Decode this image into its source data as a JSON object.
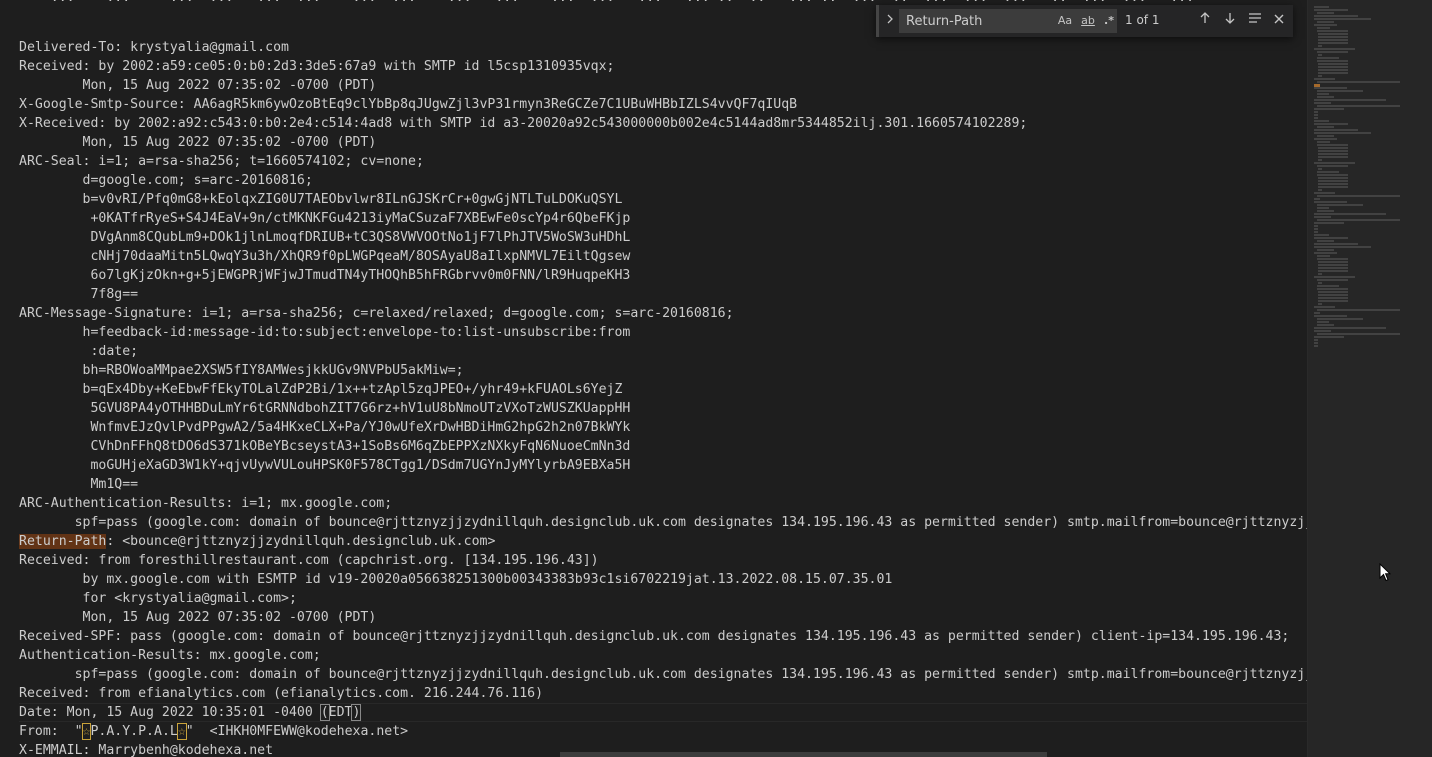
{
  "editor": {
    "cut_top_text": "    ...    ...     ...  ...   ...  ...    ...  ...    ...   ...    ...  ...   ...   ... ..  ..   ... ..  ...  ..  ...  ...  ...   ..  ...  ...   ... ",
    "lines": [
      "Delivered-To: krystyalia@gmail.com",
      "Received: by 2002:a59:ce05:0:b0:2d3:3de5:67a9 with SMTP id l5csp1310935vqx;",
      "        Mon, 15 Aug 2022 07:35:02 -0700 (PDT)",
      "X-Google-Smtp-Source: AA6agR5km6ywOzoBtEq9clYbBp8qJUgwZjl3vP31rmyn3ReGCZe7C1UBuWHBbIZLS4vvQF7qIUqB",
      "X-Received: by 2002:a92:c543:0:b0:2e4:c514:4ad8 with SMTP id a3-20020a92c543000000b002e4c5144ad8mr5344852ilj.301.1660574102289;",
      "        Mon, 15 Aug 2022 07:35:02 -0700 (PDT)",
      "ARC-Seal: i=1; a=rsa-sha256; t=1660574102; cv=none;",
      "        d=google.com; s=arc-20160816;",
      "        b=v0vRI/Pfq0mG8+kEolqxZIG0U7TAEObvlwr8ILnGJSKrCr+0gwGjNTLTuLDOKuQSYL",
      "         +0KATfrRyeS+S4J4EaV+9n/ctMKNKFGu4213iyMaCSuzaF7XBEwFe0scYp4r6QbeFKjp",
      "         DVgAnm8CQubLm9+DOk1jlnLmoqfDRIUB+tC3QS8VWVOOtNo1jF7lPhJTV5WoSW3uHDhL",
      "         cNHj70daaMitn5LQwqY3u3h/XhQR9f0pLWGPqeaM/8OSAyaU8aIlxpNMVL7EiltQgsew",
      "         6o7lgKjzOkn+g+5jEWGPRjWFjwJTmudTN4yTHOQhB5hFRGbrvv0m0FNN/lR9HuqpeKH3",
      "         7f8g==",
      "ARC-Message-Signature: i=1; a=rsa-sha256; c=relaxed/relaxed; d=google.com; s=arc-20160816;",
      "        h=feedback-id:message-id:to:subject:envelope-to:list-unsubscribe:from",
      "         :date;",
      "        bh=RBOWoaMMpae2XSW5fIY8AMWesjkkUGv9NVPbU5akMiw=;",
      "        b=qEx4Dby+KeEbwFfEkyTOLalZdP2Bi/1x++tzApl5zqJPEO+/yhr49+kFUAOLs6YejZ",
      "         5GVU8PA4yOTHHBDuLmYr6tGRNNdbohZIT7G6rz+hV1uU8bNmoUTzVXoTzWUSZKUappHH",
      "         WnfmvEJzQvlPvdPPgwA2/5a4HKxeCLX+Pa/YJ0wUfeXrDwHBDiHmG2hpG2h2n07BkWYk",
      "         CVhDnFFhQ8tDO6dS371kOBeYBcseystA3+1SoBs6M6qZbEPPXzNXkyFqN6NuoeCmNn3d",
      "         moGUHjeXaGD3W1kY+qjvUywVULouHPSK0F578CTgg1/DSdm7UGYnJyMYlyrbA9EBXa5H",
      "         Mm1Q==",
      "ARC-Authentication-Results: i=1; mx.google.com;",
      "       spf=pass (google.com: domain of bounce@rjttznyzjjzydnillquh.designclub.uk.com designates 134.195.196.43 as permitted sender) smtp.mailfrom=bounce@rjttznyzjjzydnillquh.designclub.uk.com"
    ],
    "return_path": {
      "key": "Return-Path",
      "rest": ": <bounce@rjttznyzjjzydnillquh.designclub.uk.com>"
    },
    "lines_after": [
      "Received: from foresthillrestaurant.com (capchrist.org. [134.195.196.43])",
      "        by mx.google.com with ESMTP id v19-20020a056638251300b00343383b93c1si6702219jat.13.2022.08.15.07.35.01",
      "        for <krystyalia@gmail.com>;",
      "        Mon, 15 Aug 2022 07:35:02 -0700 (PDT)",
      "Received-SPF: pass (google.com: domain of bounce@rjttznyzjjzydnillquh.designclub.uk.com designates 134.195.196.43 as permitted sender) client-ip=134.195.196.43;",
      "Authentication-Results: mx.google.com;",
      "       spf=pass (google.com: domain of bounce@rjttznyzjjzydnillquh.designclub.uk.com designates 134.195.196.43 as permitted sender) smtp.mailfrom=bounce@rjttznyzjjzydnillquh.designclub.uk.com",
      "Received: from efianalytics.com (efianalytics.com. 216.244.76.116)"
    ],
    "date_line": {
      "prefix": "Date: Mon, 15 Aug 2022 10:35:01 -0400 ",
      "paren_open": "(",
      "middle": "EDT",
      "paren_close": ")"
    },
    "from_line": {
      "prefix": "From:  \"",
      "star1": "☆",
      "middle": "P.A.Y.P.A.L",
      "star2": "☆",
      "suffix": "\"  <IHKH0MFEWW@kodehexa.net>"
    },
    "last_line": "X-EMMAIL: Marrybenh@kodehexa.net"
  },
  "find": {
    "query": "Return-Path",
    "case_label": "Aa",
    "word_label": "ab",
    "regex_label": ".*",
    "match_count": "1 of 1",
    "toggle_icon": "chevron-right-icon",
    "prev_icon": "arrow-up-icon",
    "next_icon": "arrow-down-icon",
    "selection_icon": "find-in-selection-icon",
    "close_icon": "close-icon"
  },
  "colors": {
    "background": "#1e1e1e",
    "text": "#cccccc",
    "match_highlight": "#623315",
    "find_widget": "#252526"
  }
}
